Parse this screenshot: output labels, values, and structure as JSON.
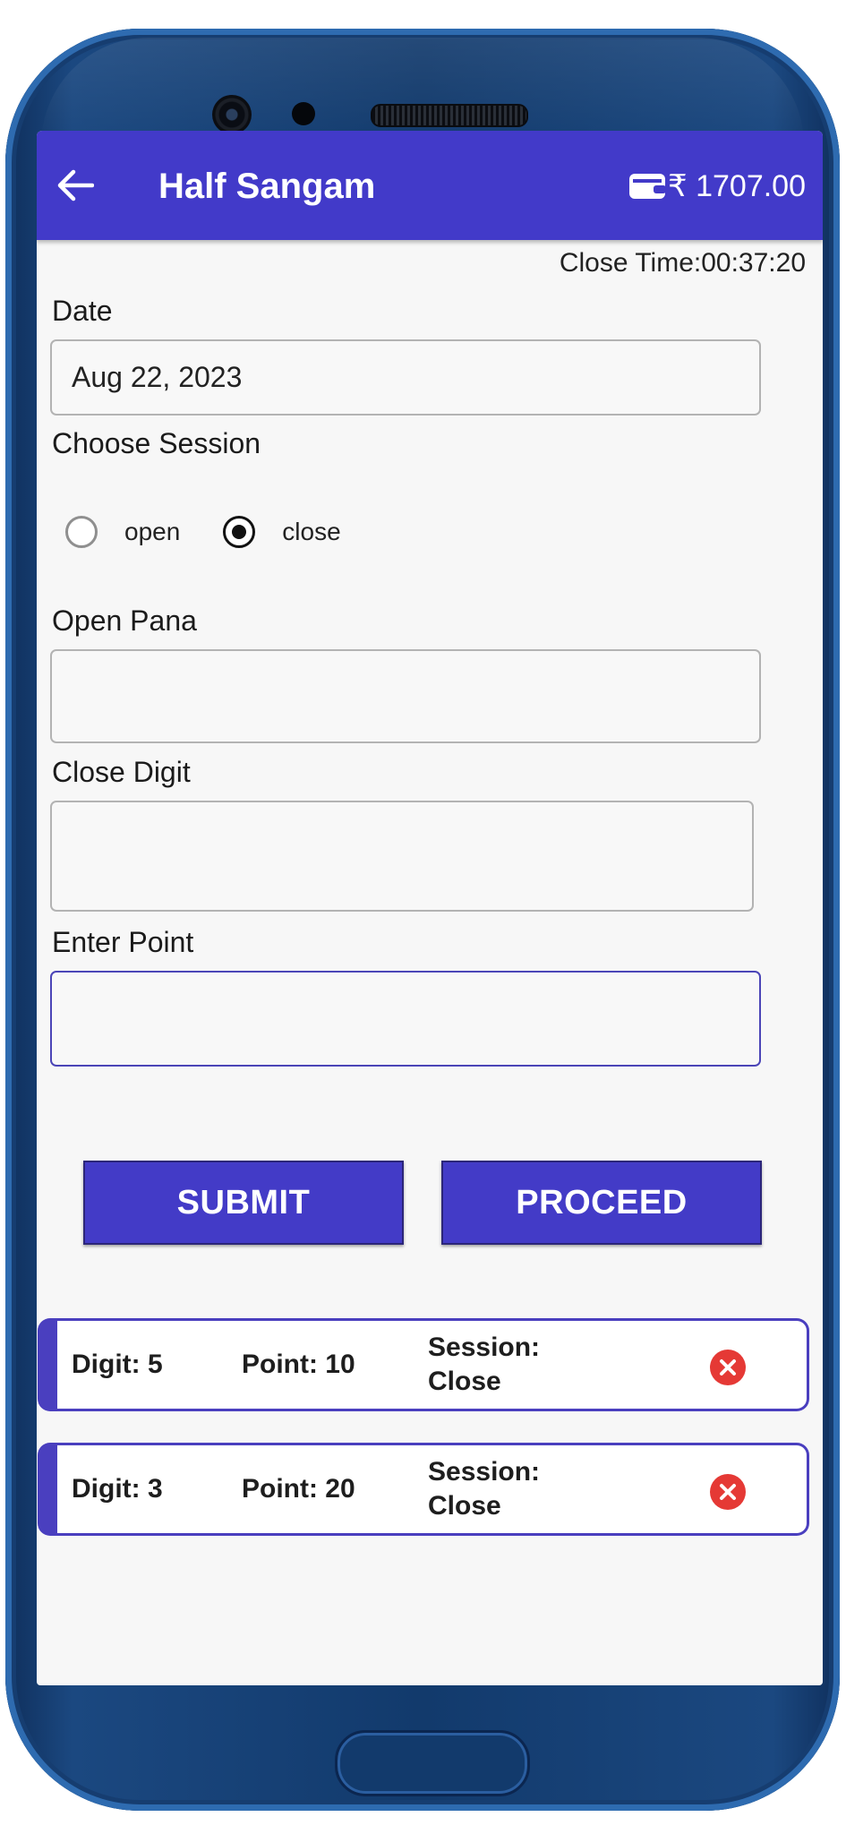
{
  "appbar": {
    "title": "Half Sangam",
    "wallet_balance": "₹ 1707.00"
  },
  "close_time": "Close Time:00:37:20",
  "form": {
    "date_label": "Date",
    "date_value": "Aug 22, 2023",
    "session_label": "Choose Session",
    "session_options": [
      {
        "label": "open",
        "selected": false
      },
      {
        "label": "close",
        "selected": true
      }
    ],
    "open_pana_label": "Open Pana",
    "open_pana_value": "",
    "close_digit_label": "Close Digit",
    "close_digit_value": "",
    "point_label": "Enter Point",
    "point_value": ""
  },
  "buttons": {
    "submit": "SUBMIT",
    "proceed": "PROCEED"
  },
  "entries": [
    {
      "digit": "Digit: 5",
      "point": "Point: 10",
      "session_title": "Session:",
      "session_value": "Close"
    },
    {
      "digit": "Digit: 3",
      "point": "Point: 20",
      "session_title": "Session:",
      "session_value": "Close"
    }
  ],
  "colors": {
    "primary": "#423ac9",
    "delete": "#e53935",
    "screen_bg": "#f7f7f7",
    "frame": "#1b4880"
  }
}
